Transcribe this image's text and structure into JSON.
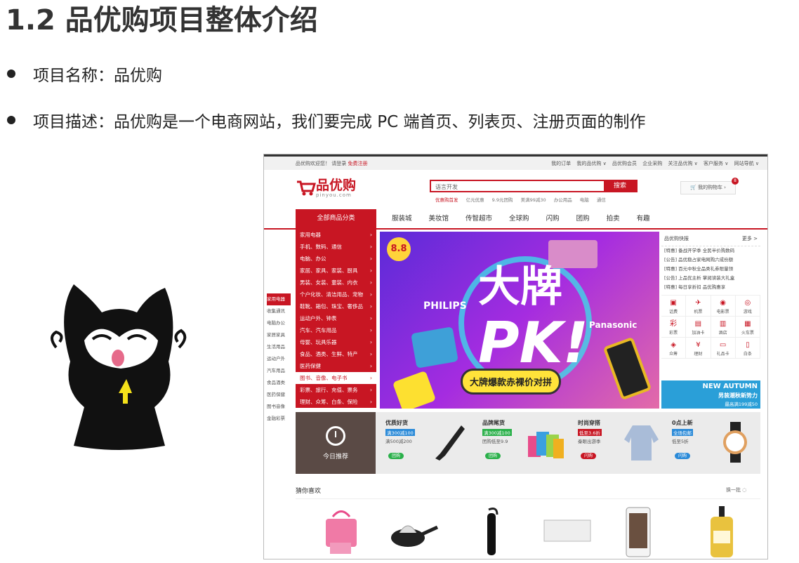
{
  "slide": {
    "title": "1.2 品优购项目整体介绍",
    "bullets": [
      "项目名称：品优购",
      "项目描述：品优购是一个电商网站，我们要完成 PC 端首页、列表页、注册页面的制作"
    ]
  },
  "site": {
    "topbar": {
      "welcome": "品优购欢迎您！",
      "login": "请登录",
      "register": "免费注册",
      "links": [
        "我的订单",
        "我的品优购 ∨",
        "品优购会员",
        "企业采购",
        "关注品优购 ∨",
        "客户服务 ∨",
        "网站导航 ∨"
      ]
    },
    "logo": {
      "name": "品优购",
      "domain": "pinyou.com"
    },
    "search": {
      "placeholder": "语言开发",
      "button": "搜索"
    },
    "hotwords": [
      "优惠购首发",
      "亿元优惠",
      "9.9元团购",
      "美满99减30",
      "办公用品",
      "电脑",
      "通信"
    ],
    "cart": {
      "label": "我的购物车",
      "count": "8"
    },
    "nav": {
      "all": "全部商品分类",
      "items": [
        "服装城",
        "美妆馆",
        "传智超市",
        "全球购",
        "闪购",
        "团购",
        "拍卖",
        "有趣"
      ]
    },
    "categories": [
      "家用电器",
      "手机、数码、通信",
      "电脑、办公",
      "家居、家具、家装、厨具",
      "男装、女装、童装、内衣",
      "个户化妆、清洁用品、宠物",
      "鞋靴、箱包、珠宝、奢侈品",
      "运动户外、钟表",
      "汽车、汽车用品",
      "母婴、玩具乐器",
      "食品、酒类、生鲜、特产",
      "医药保健",
      "图书、音像、电子书",
      "彩票、旅行、充值、票务",
      "理财、众筹、白条、保险"
    ],
    "left_nav": [
      "家用电器",
      "收集通讯",
      "电脑办公",
      "家居家具",
      "生活用品",
      "运动户外",
      "汽车用品",
      "食品酒类",
      "医药保健",
      "图书音像",
      "金融彩票"
    ],
    "banner": {
      "badge": "8.8",
      "line1": "大牌",
      "line2": "PK!",
      "brand1": "PHILIPS",
      "brand2": "Panasonic",
      "slogan": "大牌爆款赤裸价对拼"
    },
    "news": {
      "title": "品优购快报",
      "more": "更多 >",
      "items": [
        "[特惠] 备战开学季 全民半价购数码",
        "[公告] 品优稳占家电网购六成份额",
        "[特惠] 百元中秋全品类礼券限量领",
        "[公告] 上品优主析 掌阅读装大礼盒",
        "[特惠] 每日享折扣 品优购惠享"
      ],
      "services": [
        {
          "icon": "▣",
          "label": "话费"
        },
        {
          "icon": "✈",
          "label": "机票"
        },
        {
          "icon": "◉",
          "label": "电影票"
        },
        {
          "icon": "◎",
          "label": "游戏"
        },
        {
          "icon": "彩",
          "label": "彩票"
        },
        {
          "icon": "▤",
          "label": "加油卡"
        },
        {
          "icon": "▥",
          "label": "酒店"
        },
        {
          "icon": "▦",
          "label": "火车票"
        },
        {
          "icon": "◈",
          "label": "众筹"
        },
        {
          "icon": "¥",
          "label": "理财"
        },
        {
          "icon": "▭",
          "label": "礼品卡"
        },
        {
          "icon": "▯",
          "label": "白条"
        }
      ],
      "ad1": "NEW AUTUMN",
      "ad2": "男装潮秋新势力",
      "ad3": "最高满199减50"
    },
    "recommend": {
      "today": "今日推荐",
      "cells": [
        {
          "title": "优质好货",
          "tag": "满300减100",
          "sub": "满500减200",
          "pill": "团购",
          "pill_color": "#2ab04a"
        },
        {
          "title": "品牌尾货",
          "tag": "满300减100",
          "sub": "团购低至9.9",
          "pill": "团购",
          "pill_color": "#2ab04a"
        },
        {
          "title": "时尚穿搭",
          "tag": "低至3.6折",
          "sub": "秦眼出游季",
          "pill": "闪购",
          "pill_color": "#c81623"
        },
        {
          "title": "0点上新",
          "tag": "全场包邮",
          "sub": "低至5折",
          "pill": "闪购",
          "pill_color": "#2a8ad8"
        }
      ]
    },
    "guess": {
      "title": "猜你喜欢",
      "refresh": "换一批 ◌"
    }
  }
}
